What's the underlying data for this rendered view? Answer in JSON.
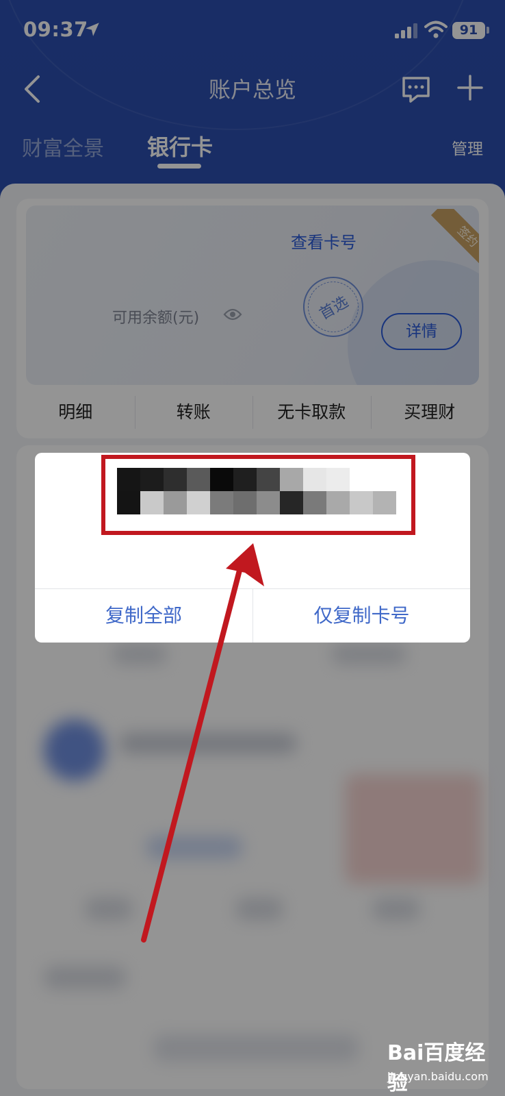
{
  "status_bar": {
    "time": "09:37",
    "battery": "91"
  },
  "nav": {
    "title": "账户总览"
  },
  "tabs": {
    "wealth": "财富全景",
    "bank_card": "银行卡",
    "manage": "管理"
  },
  "card": {
    "view_number": "查看卡号",
    "balance_label": "可用余额(元)",
    "preferred_stamp": "首选",
    "detail_button": "详情",
    "sign_ribbon": "签约"
  },
  "actions": [
    "明细",
    "转账",
    "无卡取款",
    "买理财"
  ],
  "popup": {
    "copy_all": "复制全部",
    "copy_card_number": "仅复制卡号"
  },
  "watermark": {
    "logo": "Bai百度经验",
    "url": "jingyan.baidu.com"
  },
  "colors": {
    "header_blue": "#2b4eae",
    "link_blue": "#3f68c8",
    "annotation_red": "#c1181f"
  }
}
